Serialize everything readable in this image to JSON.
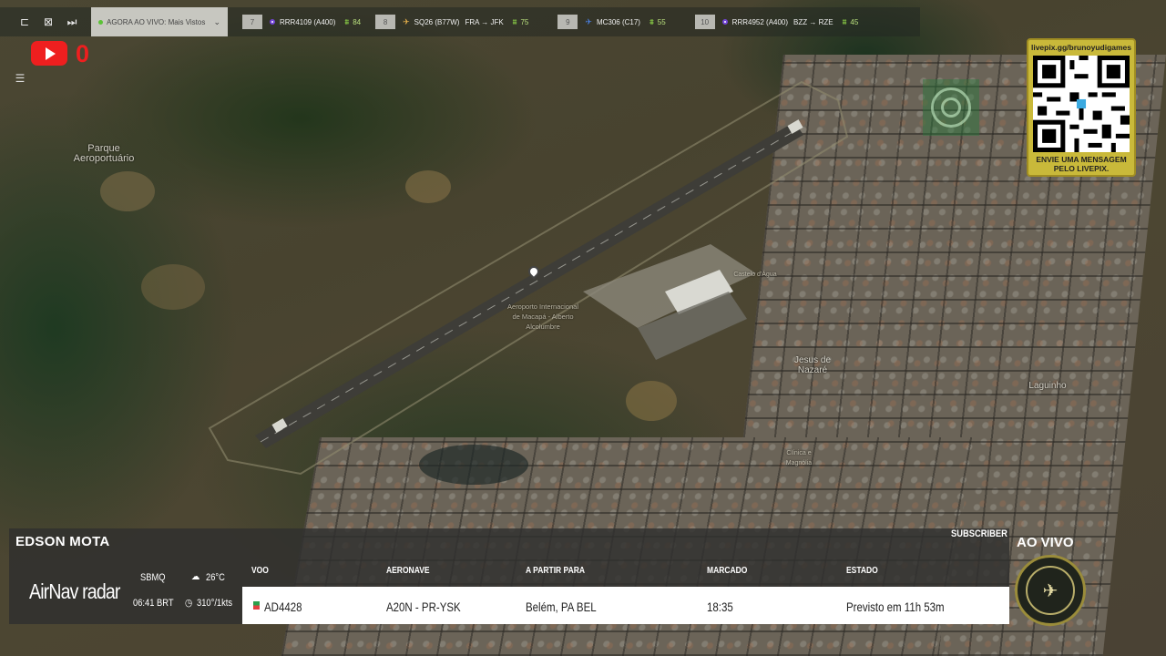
{
  "topbar": {
    "live_label": "AGORA AO VIVO: Mais Vistos",
    "items": [
      {
        "num": "7",
        "flight": "RRR4109 (A400)",
        "route": "",
        "count": "84"
      },
      {
        "num": "8",
        "flight": "SQ26 (B77W)",
        "route": "FRA → JFK",
        "count": "75"
      },
      {
        "num": "9",
        "flight": "MC306 (C17)",
        "route": "",
        "count": "55"
      },
      {
        "num": "10",
        "flight": "RRR4952 (A400)",
        "route": "BZZ → RZE",
        "count": "45"
      }
    ]
  },
  "youtube": {
    "count": "0"
  },
  "map": {
    "labels": {
      "park": "Parque\nAeroportuário",
      "airport": "Aeroporto Internacional\nde Macapá - Alberto\nAlcolumbre",
      "water_tank": "Castelo d'Água",
      "jesus": "Jesus de\nNazaré",
      "laguinho": "Laguinho",
      "clinic": "Clínica e\nMagnólia"
    }
  },
  "qr": {
    "url": "livepix.gg/brunoyudigames",
    "message": "ENVIE UMA MENSAGEM\nPELO LIVEPIX."
  },
  "panel": {
    "pilot": "EDSON MOTA",
    "brand": "AirNav radar",
    "airport": "SBMQ",
    "temp": "26°C",
    "time": "06:41 BRT",
    "wind": "310°/1kts",
    "headers": {
      "flight": "VOO",
      "aircraft": "AERONAVE",
      "from_to": "A PARTIR PARA",
      "scheduled": "MARCADO",
      "status": "ESTADO"
    },
    "row": {
      "flight": "AD4428",
      "aircraft": "A20N - PR-YSK",
      "from_to": "Belém, PA BEL",
      "scheduled": "18:35",
      "status": "Previsto em 11h 53m"
    }
  },
  "subscriber": "SUBSCRIBER",
  "live": "AO VIVO",
  "colors": {
    "youtube": "#ee1f1f",
    "qr_bg": "#c9b93a",
    "accent_green": "#8ed448"
  }
}
